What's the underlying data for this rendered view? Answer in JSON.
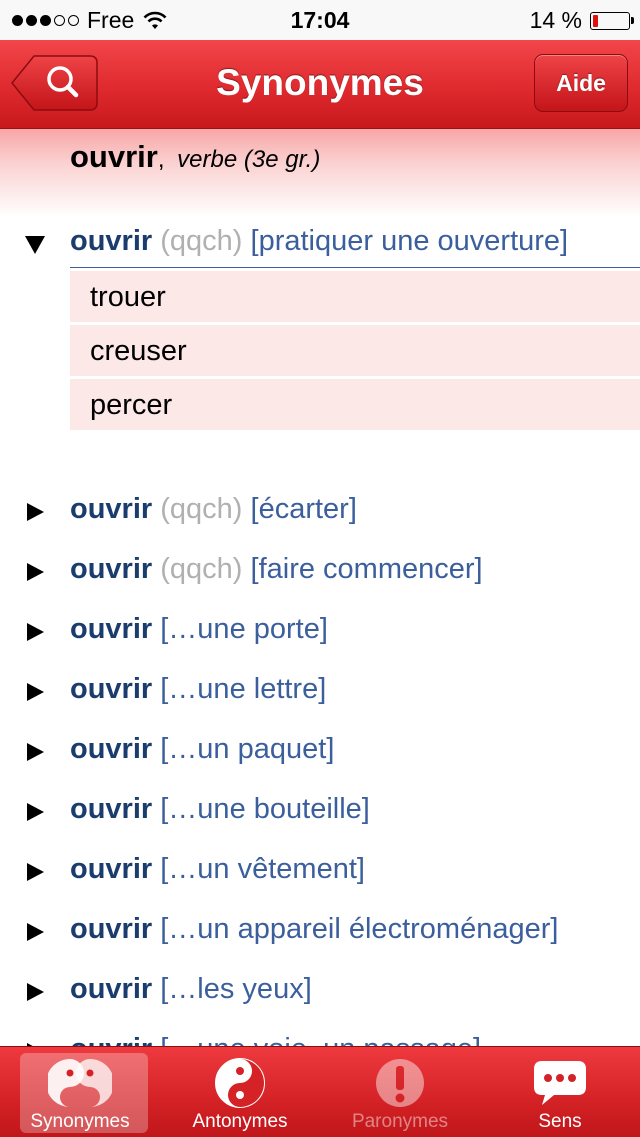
{
  "status": {
    "carrier": "Free",
    "time": "17:04",
    "battery": "14 %",
    "battery_fraction": 0.14
  },
  "nav": {
    "title": "Synonymes",
    "help_label": "Aide"
  },
  "entry": {
    "word": "ouvrir",
    "separator": ",",
    "grammar": "verbe (3e gr.)"
  },
  "senses": [
    {
      "word": "ouvrir",
      "qualifier": "(qqch)",
      "gloss": "[pratiquer une ouverture]",
      "expanded": true,
      "synonyms": [
        "trouer",
        "creuser",
        "percer"
      ]
    },
    {
      "word": "ouvrir",
      "qualifier": "(qqch)",
      "gloss": "[écarter]"
    },
    {
      "word": "ouvrir",
      "qualifier": "(qqch)",
      "gloss": "[faire commencer]"
    },
    {
      "word": "ouvrir",
      "qualifier": "",
      "gloss": "[…une porte]"
    },
    {
      "word": "ouvrir",
      "qualifier": "",
      "gloss": "[…une lettre]"
    },
    {
      "word": "ouvrir",
      "qualifier": "",
      "gloss": "[…un paquet]"
    },
    {
      "word": "ouvrir",
      "qualifier": "",
      "gloss": "[…une bouteille]"
    },
    {
      "word": "ouvrir",
      "qualifier": "",
      "gloss": "[…un vêtement]"
    },
    {
      "word": "ouvrir",
      "qualifier": "",
      "gloss": "[…un appareil électroménager]"
    },
    {
      "word": "ouvrir",
      "qualifier": "",
      "gloss": "[…les yeux]"
    },
    {
      "word": "ouvrir",
      "qualifier": "",
      "gloss": "[…une voie, un passage]"
    }
  ],
  "tabs": [
    {
      "label": "Synonymes",
      "icon": "synonyms-icon",
      "selected": true
    },
    {
      "label": "Antonymes",
      "icon": "yin-yang-icon"
    },
    {
      "label": "Paronymes",
      "icon": "exclamation-icon",
      "disabled": true
    },
    {
      "label": "Sens",
      "icon": "speech-bubble-icon"
    }
  ]
}
